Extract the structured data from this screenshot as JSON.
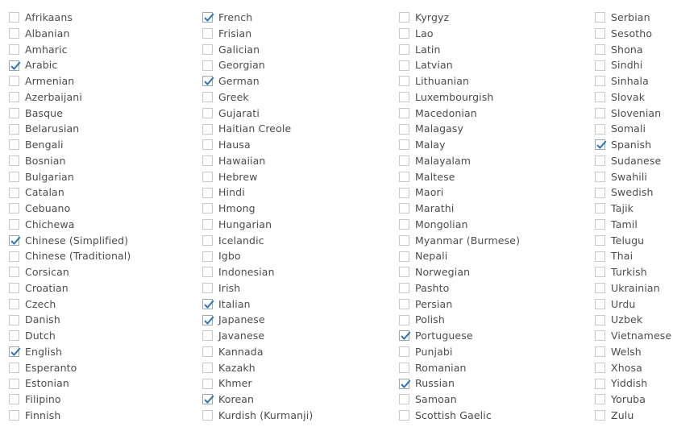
{
  "panel": {
    "name": "language-selection-grid",
    "columns_count": 4,
    "checkbox_checked_color": "#2e75b6",
    "checkbox_border_color": "#c8c8c8",
    "checkbox_checked_border_color": "#9aa6b0",
    "label_color": "#4c4c4c",
    "background_color": "#ffffff"
  },
  "columns": [
    {
      "name": "column-1",
      "items": [
        {
          "label": "Afrikaans",
          "checked": false
        },
        {
          "label": "Albanian",
          "checked": false
        },
        {
          "label": "Amharic",
          "checked": false
        },
        {
          "label": "Arabic",
          "checked": true
        },
        {
          "label": "Armenian",
          "checked": false
        },
        {
          "label": "Azerbaijani",
          "checked": false
        },
        {
          "label": "Basque",
          "checked": false
        },
        {
          "label": "Belarusian",
          "checked": false
        },
        {
          "label": "Bengali",
          "checked": false
        },
        {
          "label": "Bosnian",
          "checked": false
        },
        {
          "label": "Bulgarian",
          "checked": false
        },
        {
          "label": "Catalan",
          "checked": false
        },
        {
          "label": "Cebuano",
          "checked": false
        },
        {
          "label": "Chichewa",
          "checked": false
        },
        {
          "label": "Chinese (Simplified)",
          "checked": true
        },
        {
          "label": "Chinese (Traditional)",
          "checked": false
        },
        {
          "label": "Corsican",
          "checked": false
        },
        {
          "label": "Croatian",
          "checked": false
        },
        {
          "label": "Czech",
          "checked": false
        },
        {
          "label": "Danish",
          "checked": false
        },
        {
          "label": "Dutch",
          "checked": false
        },
        {
          "label": "English",
          "checked": true
        },
        {
          "label": "Esperanto",
          "checked": false
        },
        {
          "label": "Estonian",
          "checked": false
        },
        {
          "label": "Filipino",
          "checked": false
        },
        {
          "label": "Finnish",
          "checked": false
        }
      ]
    },
    {
      "name": "column-2",
      "items": [
        {
          "label": "French",
          "checked": true
        },
        {
          "label": "Frisian",
          "checked": false
        },
        {
          "label": "Galician",
          "checked": false
        },
        {
          "label": "Georgian",
          "checked": false
        },
        {
          "label": "German",
          "checked": true
        },
        {
          "label": "Greek",
          "checked": false
        },
        {
          "label": "Gujarati",
          "checked": false
        },
        {
          "label": "Haitian Creole",
          "checked": false
        },
        {
          "label": "Hausa",
          "checked": false
        },
        {
          "label": "Hawaiian",
          "checked": false
        },
        {
          "label": "Hebrew",
          "checked": false
        },
        {
          "label": "Hindi",
          "checked": false
        },
        {
          "label": "Hmong",
          "checked": false
        },
        {
          "label": "Hungarian",
          "checked": false
        },
        {
          "label": "Icelandic",
          "checked": false
        },
        {
          "label": "Igbo",
          "checked": false
        },
        {
          "label": "Indonesian",
          "checked": false
        },
        {
          "label": "Irish",
          "checked": false
        },
        {
          "label": "Italian",
          "checked": true
        },
        {
          "label": "Japanese",
          "checked": true
        },
        {
          "label": "Javanese",
          "checked": false
        },
        {
          "label": "Kannada",
          "checked": false
        },
        {
          "label": "Kazakh",
          "checked": false
        },
        {
          "label": "Khmer",
          "checked": false
        },
        {
          "label": "Korean",
          "checked": true
        },
        {
          "label": "Kurdish (Kurmanji)",
          "checked": false
        }
      ]
    },
    {
      "name": "column-3",
      "items": [
        {
          "label": "Kyrgyz",
          "checked": false
        },
        {
          "label": "Lao",
          "checked": false
        },
        {
          "label": "Latin",
          "checked": false
        },
        {
          "label": "Latvian",
          "checked": false
        },
        {
          "label": "Lithuanian",
          "checked": false
        },
        {
          "label": "Luxembourgish",
          "checked": false
        },
        {
          "label": "Macedonian",
          "checked": false
        },
        {
          "label": "Malagasy",
          "checked": false
        },
        {
          "label": "Malay",
          "checked": false
        },
        {
          "label": "Malayalam",
          "checked": false
        },
        {
          "label": "Maltese",
          "checked": false
        },
        {
          "label": "Maori",
          "checked": false
        },
        {
          "label": "Marathi",
          "checked": false
        },
        {
          "label": "Mongolian",
          "checked": false
        },
        {
          "label": "Myanmar (Burmese)",
          "checked": false
        },
        {
          "label": "Nepali",
          "checked": false
        },
        {
          "label": "Norwegian",
          "checked": false
        },
        {
          "label": "Pashto",
          "checked": false
        },
        {
          "label": "Persian",
          "checked": false
        },
        {
          "label": "Polish",
          "checked": false
        },
        {
          "label": "Portuguese",
          "checked": true
        },
        {
          "label": "Punjabi",
          "checked": false
        },
        {
          "label": "Romanian",
          "checked": false
        },
        {
          "label": "Russian",
          "checked": true
        },
        {
          "label": "Samoan",
          "checked": false
        },
        {
          "label": "Scottish Gaelic",
          "checked": false
        }
      ]
    },
    {
      "name": "column-4",
      "items": [
        {
          "label": "Serbian",
          "checked": false
        },
        {
          "label": "Sesotho",
          "checked": false
        },
        {
          "label": "Shona",
          "checked": false
        },
        {
          "label": "Sindhi",
          "checked": false
        },
        {
          "label": "Sinhala",
          "checked": false
        },
        {
          "label": "Slovak",
          "checked": false
        },
        {
          "label": "Slovenian",
          "checked": false
        },
        {
          "label": "Somali",
          "checked": false
        },
        {
          "label": "Spanish",
          "checked": true
        },
        {
          "label": "Sudanese",
          "checked": false
        },
        {
          "label": "Swahili",
          "checked": false
        },
        {
          "label": "Swedish",
          "checked": false
        },
        {
          "label": "Tajik",
          "checked": false
        },
        {
          "label": "Tamil",
          "checked": false
        },
        {
          "label": "Telugu",
          "checked": false
        },
        {
          "label": "Thai",
          "checked": false
        },
        {
          "label": "Turkish",
          "checked": false
        },
        {
          "label": "Ukrainian",
          "checked": false
        },
        {
          "label": "Urdu",
          "checked": false
        },
        {
          "label": "Uzbek",
          "checked": false
        },
        {
          "label": "Vietnamese",
          "checked": false
        },
        {
          "label": "Welsh",
          "checked": false
        },
        {
          "label": "Xhosa",
          "checked": false
        },
        {
          "label": "Yiddish",
          "checked": false
        },
        {
          "label": "Yoruba",
          "checked": false
        },
        {
          "label": "Zulu",
          "checked": false
        }
      ]
    }
  ]
}
